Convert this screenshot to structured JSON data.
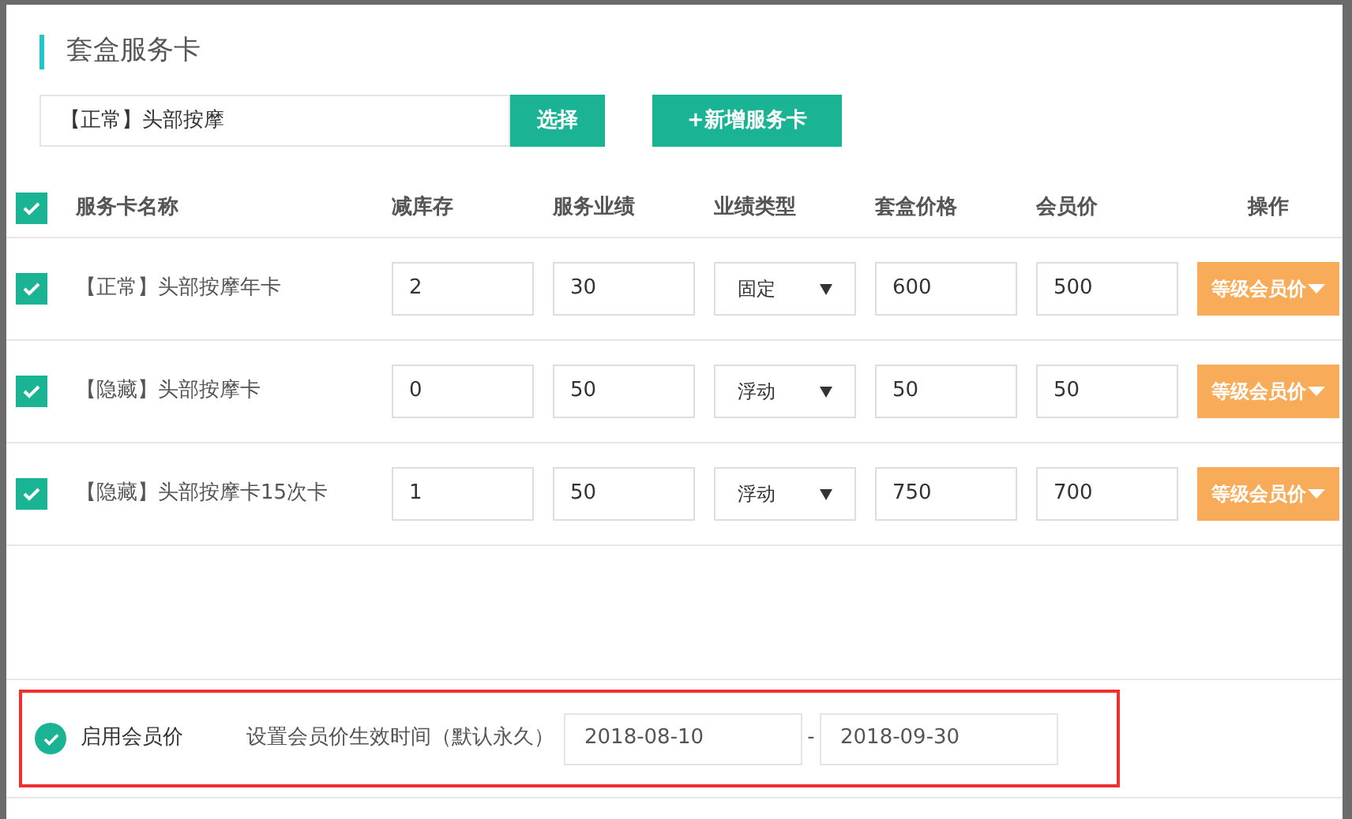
{
  "section_title": "套盒服务卡",
  "search": {
    "value": "【正常】头部按摩",
    "button": "选择"
  },
  "add_button": "+新增服务卡",
  "table": {
    "all_checked": true,
    "columns": [
      "服务卡名称",
      "减库存",
      "服务业绩",
      "业绩类型",
      "套盒价格",
      "会员价",
      "操作"
    ],
    "rows": [
      {
        "checked": true,
        "name": "【正常】头部按摩年卡",
        "stock": "2",
        "performance": "30",
        "type": "固定",
        "box_price": "600",
        "member_price": "500",
        "action": "等级会员价"
      },
      {
        "checked": true,
        "name": "【隐藏】头部按摩卡",
        "stock": "0",
        "performance": "50",
        "type": "浮动",
        "box_price": "50",
        "member_price": "50",
        "action": "等级会员价"
      },
      {
        "checked": true,
        "name": "【隐藏】头部按摩卡15次卡",
        "stock": "1",
        "performance": "50",
        "type": "浮动",
        "box_price": "750",
        "member_price": "700",
        "action": "等级会员价"
      }
    ]
  },
  "member_price": {
    "highlighted": true,
    "enabled": true,
    "label": "启用会员价",
    "time_label": "设置会员价生效时间（默认永久）",
    "start": "2018-08-10",
    "separator": "-",
    "end": "2018-09-30"
  }
}
